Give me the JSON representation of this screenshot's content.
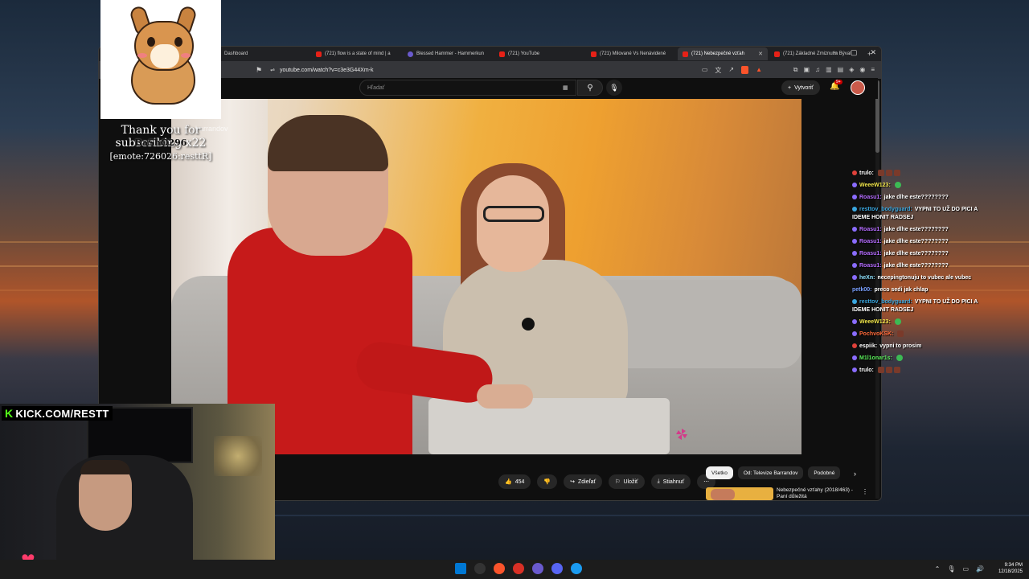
{
  "browser": {
    "tabs": [
      {
        "label": "Dashboard",
        "active": false
      },
      {
        "label": "(721) flow is a state of mind | a",
        "active": false
      },
      {
        "label": "Blessed Hammer - Hammerkun",
        "active": false
      },
      {
        "label": "(721) YouTube",
        "active": false
      },
      {
        "label": "(721) Milované Vs Nenávidené",
        "active": false
      },
      {
        "label": "(721) Nebezpečné vzťah",
        "active": true
      },
      {
        "label": "(721) Základné Zmiznutia Býval",
        "active": false
      }
    ],
    "new_tab": "+",
    "window_controls": {
      "minimize": "−",
      "maximize": "▢",
      "close": "✕"
    },
    "url": "youtube.com/watch?v=c3e3G44Xm-k",
    "ext_badge": "9"
  },
  "youtube": {
    "search_placeholder": "Hľadať",
    "create_label": "Vytvoriť",
    "notifications_badge": "9+",
    "actions": {
      "like_count": "454",
      "share": "Zdieľať",
      "save": "Uložiť",
      "download": "Stiahnuť",
      "more": "⋯"
    },
    "chips": [
      "Všetko",
      "Od: Televize Barrandov",
      "Podobné"
    ],
    "recommendation": {
      "title": "Nebezpečné vzťahy (2018/463) - Paní důležitá"
    },
    "video_watermark": "barrandov"
  },
  "sub_alert": {
    "text": "Thank you for subscribing x22",
    "user": "BaShO296",
    "emote": "[emote:726026:resttR]"
  },
  "chat": [
    {
      "user": "trulo:",
      "text": "",
      "color": "#ffffff",
      "badge": "#e0413a",
      "emotes": 3
    },
    {
      "user": "WeeeW123:",
      "text": "",
      "color": "#f0e54a",
      "badge": "#8a6cff",
      "emotes": 1,
      "green": true
    },
    {
      "user": "Roasu1:",
      "text": "jake dlhe este????????",
      "color": "#b56cff",
      "badge": "#8a6cff",
      "emotes": 0
    },
    {
      "user": "resttov_bodyguard:",
      "text": "VYPNI TO UŽ DO PICI A IDEME HONIT RADSEJ",
      "color": "#3aa7e0",
      "badge": "#3aa7e0",
      "emotes": 0
    },
    {
      "user": "Roasu1:",
      "text": "jake dlhe este????????",
      "color": "#b56cff",
      "badge": "#8a6cff",
      "emotes": 0
    },
    {
      "user": "Roasu1:",
      "text": "jake dlhe este????????",
      "color": "#b56cff",
      "badge": "#8a6cff",
      "emotes": 0
    },
    {
      "user": "Roasu1:",
      "text": "jake dlhe este????????",
      "color": "#b56cff",
      "badge": "#8a6cff",
      "emotes": 0
    },
    {
      "user": "Roasu1:",
      "text": "jake dlhe este????????",
      "color": "#b56cff",
      "badge": "#8a6cff",
      "emotes": 0
    },
    {
      "user": "heXn:",
      "text": "necepingtonuju to vubec ale vubec",
      "color": "#8fe3ff",
      "badge": "#8a6cff",
      "emotes": 0
    },
    {
      "user": "petk00:",
      "text": "preco sedi jak chlap",
      "color": "#7aa0ff",
      "badge": "",
      "emotes": 0
    },
    {
      "user": "resttov_bodyguard:",
      "text": "VYPNI TO UŽ DO PICI A IDEME HONIT RADSEJ",
      "color": "#3aa7e0",
      "badge": "#3aa7e0",
      "emotes": 0
    },
    {
      "user": "WeeeW123:",
      "text": "",
      "color": "#f0e54a",
      "badge": "#8a6cff",
      "emotes": 1,
      "green": true
    },
    {
      "user": "PochvoKSK:",
      "text": "",
      "color": "#ff6a3a",
      "badge": "#8a6cff",
      "emotes": 1
    },
    {
      "user": "espiik:",
      "text": "vypni to prosim",
      "color": "#ffffff",
      "badge": "#e0413a",
      "emotes": 0
    },
    {
      "user": "M1l1onar1s:",
      "text": "",
      "color": "#5bf05b",
      "badge": "#8a6cff",
      "emotes": 1,
      "green": true
    },
    {
      "user": "trulo:",
      "text": "",
      "color": "#ffffff",
      "badge": "#8a6cff",
      "emotes": 3
    }
  ],
  "stream": {
    "kick_url": "KICK.COM/RESTT",
    "kick_k": "K"
  },
  "taskbar": {
    "time": "9:34 PM",
    "date": "12/18/2025",
    "icon_colors": [
      "#0078d4",
      "#333333",
      "#fb542b",
      "#d93025",
      "#6a5acd",
      "#5865f2",
      "#1b9bf0"
    ]
  }
}
